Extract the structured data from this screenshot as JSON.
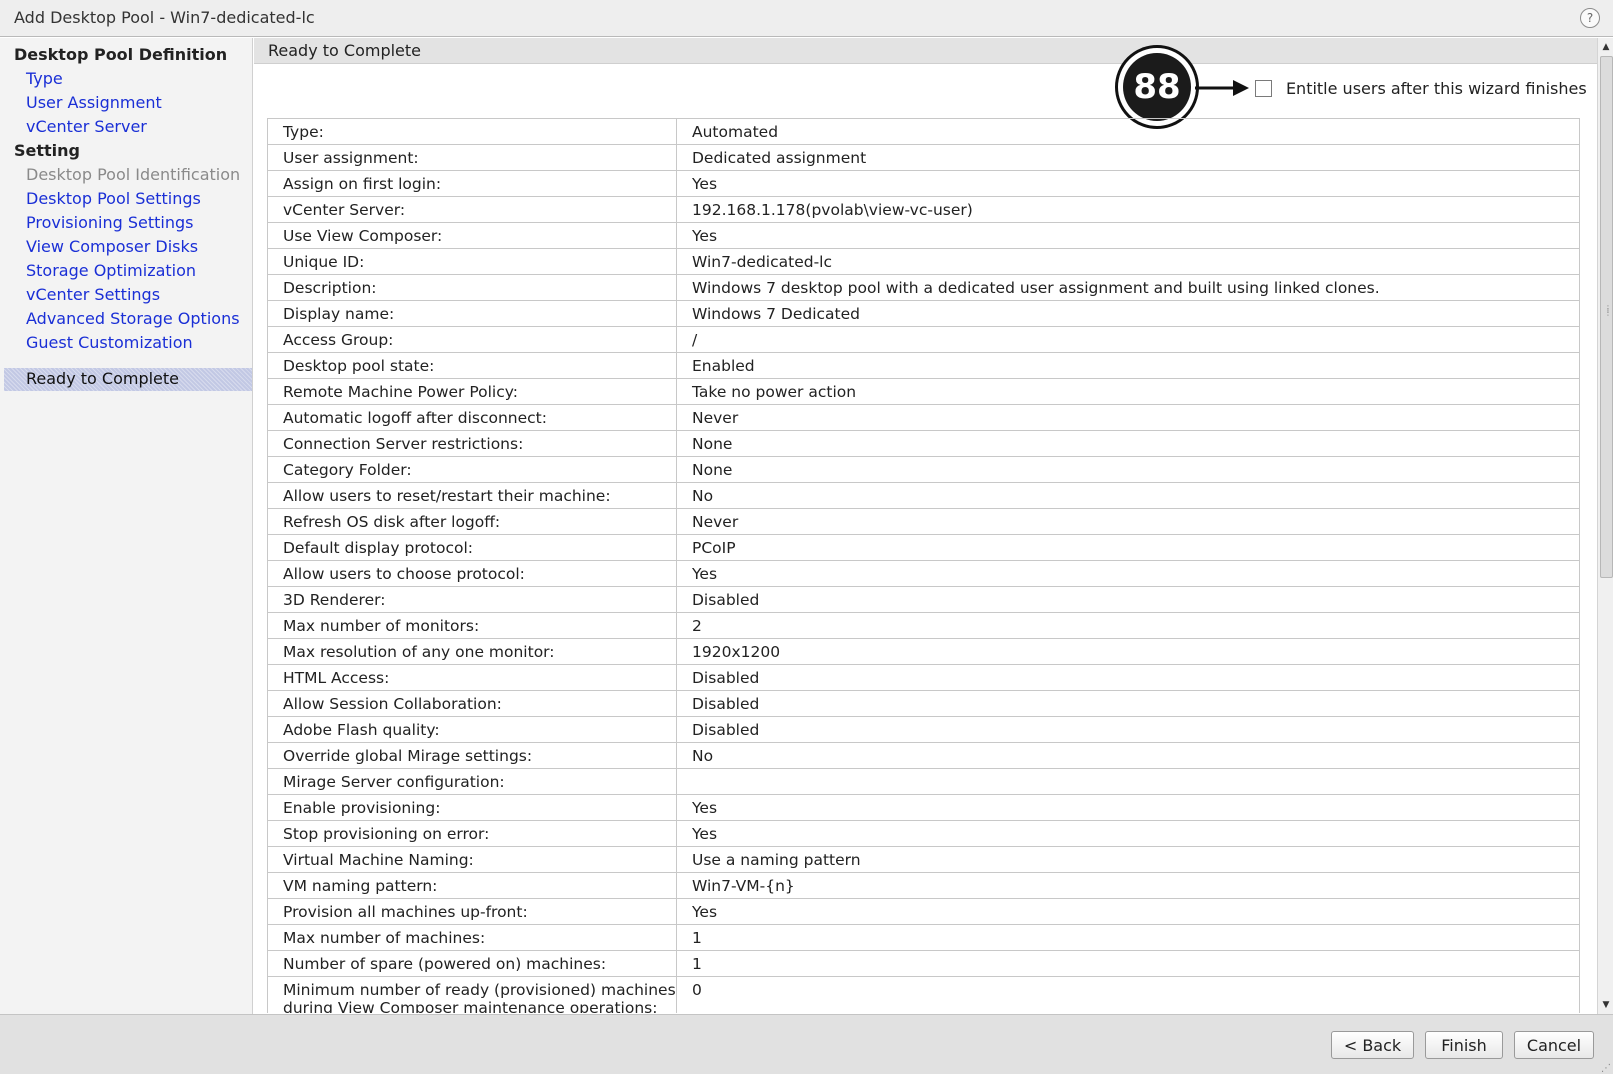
{
  "window": {
    "title": "Add Desktop Pool - Win7-dedicated-lc",
    "help_icon": "?"
  },
  "sidebar": {
    "sections": [
      {
        "label": "Desktop Pool Definition"
      },
      {
        "label": "Setting"
      }
    ],
    "items": [
      {
        "label": "Type",
        "state": "link"
      },
      {
        "label": "User Assignment",
        "state": "link"
      },
      {
        "label": "vCenter Server",
        "state": "link"
      },
      {
        "label": "Desktop Pool Identification",
        "state": "disabled"
      },
      {
        "label": "Desktop Pool Settings",
        "state": "link"
      },
      {
        "label": "Provisioning Settings",
        "state": "link"
      },
      {
        "label": "View Composer Disks",
        "state": "link"
      },
      {
        "label": "Storage Optimization",
        "state": "link"
      },
      {
        "label": "vCenter Settings",
        "state": "link"
      },
      {
        "label": "Advanced Storage Options",
        "state": "link"
      },
      {
        "label": "Guest Customization",
        "state": "link"
      },
      {
        "label": "Ready to Complete",
        "state": "selected"
      }
    ]
  },
  "main": {
    "header": "Ready to Complete",
    "entitle_checkbox": {
      "label": "Entitle users after this wizard finishes",
      "checked": false
    },
    "callout": "88",
    "rows": [
      {
        "label": "Type:",
        "value": "Automated"
      },
      {
        "label": "User assignment:",
        "value": "Dedicated assignment"
      },
      {
        "label": "Assign on first login:",
        "value": "Yes"
      },
      {
        "label": "vCenter Server:",
        "value": "192.168.1.178(pvolab\\view-vc-user)"
      },
      {
        "label": "Use View Composer:",
        "value": "Yes"
      },
      {
        "label": "Unique ID:",
        "value": "Win7-dedicated-lc"
      },
      {
        "label": "Description:",
        "value": "Windows 7 desktop pool with a dedicated user assignment and built using linked clones."
      },
      {
        "label": "Display name:",
        "value": "Windows 7 Dedicated"
      },
      {
        "label": "Access Group:",
        "value": "/"
      },
      {
        "label": "Desktop pool state:",
        "value": "Enabled"
      },
      {
        "label": "Remote Machine Power Policy:",
        "value": "Take no power action"
      },
      {
        "label": "Automatic logoff after disconnect:",
        "value": "Never"
      },
      {
        "label": "Connection Server restrictions:",
        "value": "None"
      },
      {
        "label": "Category Folder:",
        "value": "None"
      },
      {
        "label": "Allow users to reset/restart their machine:",
        "value": "No"
      },
      {
        "label": "Refresh OS disk after logoff:",
        "value": "Never"
      },
      {
        "label": "Default display protocol:",
        "value": "PCoIP"
      },
      {
        "label": "Allow users to choose protocol:",
        "value": "Yes"
      },
      {
        "label": "3D Renderer:",
        "value": "Disabled"
      },
      {
        "label": "Max number of monitors:",
        "value": "2"
      },
      {
        "label": "Max resolution of any one monitor:",
        "value": "1920x1200"
      },
      {
        "label": "HTML Access:",
        "value": "Disabled"
      },
      {
        "label": "Allow Session Collaboration:",
        "value": "Disabled"
      },
      {
        "label": "Adobe Flash quality:",
        "value": "Disabled"
      },
      {
        "label": "Override global Mirage settings:",
        "value": "No"
      },
      {
        "label": "Mirage Server configuration:",
        "value": ""
      },
      {
        "label": "Enable provisioning:",
        "value": "Yes"
      },
      {
        "label": "Stop provisioning on error:",
        "value": "Yes"
      },
      {
        "label": "Virtual Machine Naming:",
        "value": "Use a naming pattern"
      },
      {
        "label": "VM naming pattern:",
        "value": "Win7-VM-{n}"
      },
      {
        "label": "Provision all machines up-front:",
        "value": "Yes"
      },
      {
        "label": "Max number of machines:",
        "value": "1"
      },
      {
        "label": "Number of spare (powered on) machines:",
        "value": "1"
      },
      {
        "label": "Minimum number of ready (provisioned) machines during View Composer maintenance operations:",
        "value": "0"
      }
    ]
  },
  "footer": {
    "back_label": "< Back",
    "finish_label": "Finish",
    "cancel_label": "Cancel"
  },
  "colors": {
    "link": "#1a2fd6",
    "disabled": "#8a8a8a",
    "selected_bg": "#c2c8e4"
  }
}
